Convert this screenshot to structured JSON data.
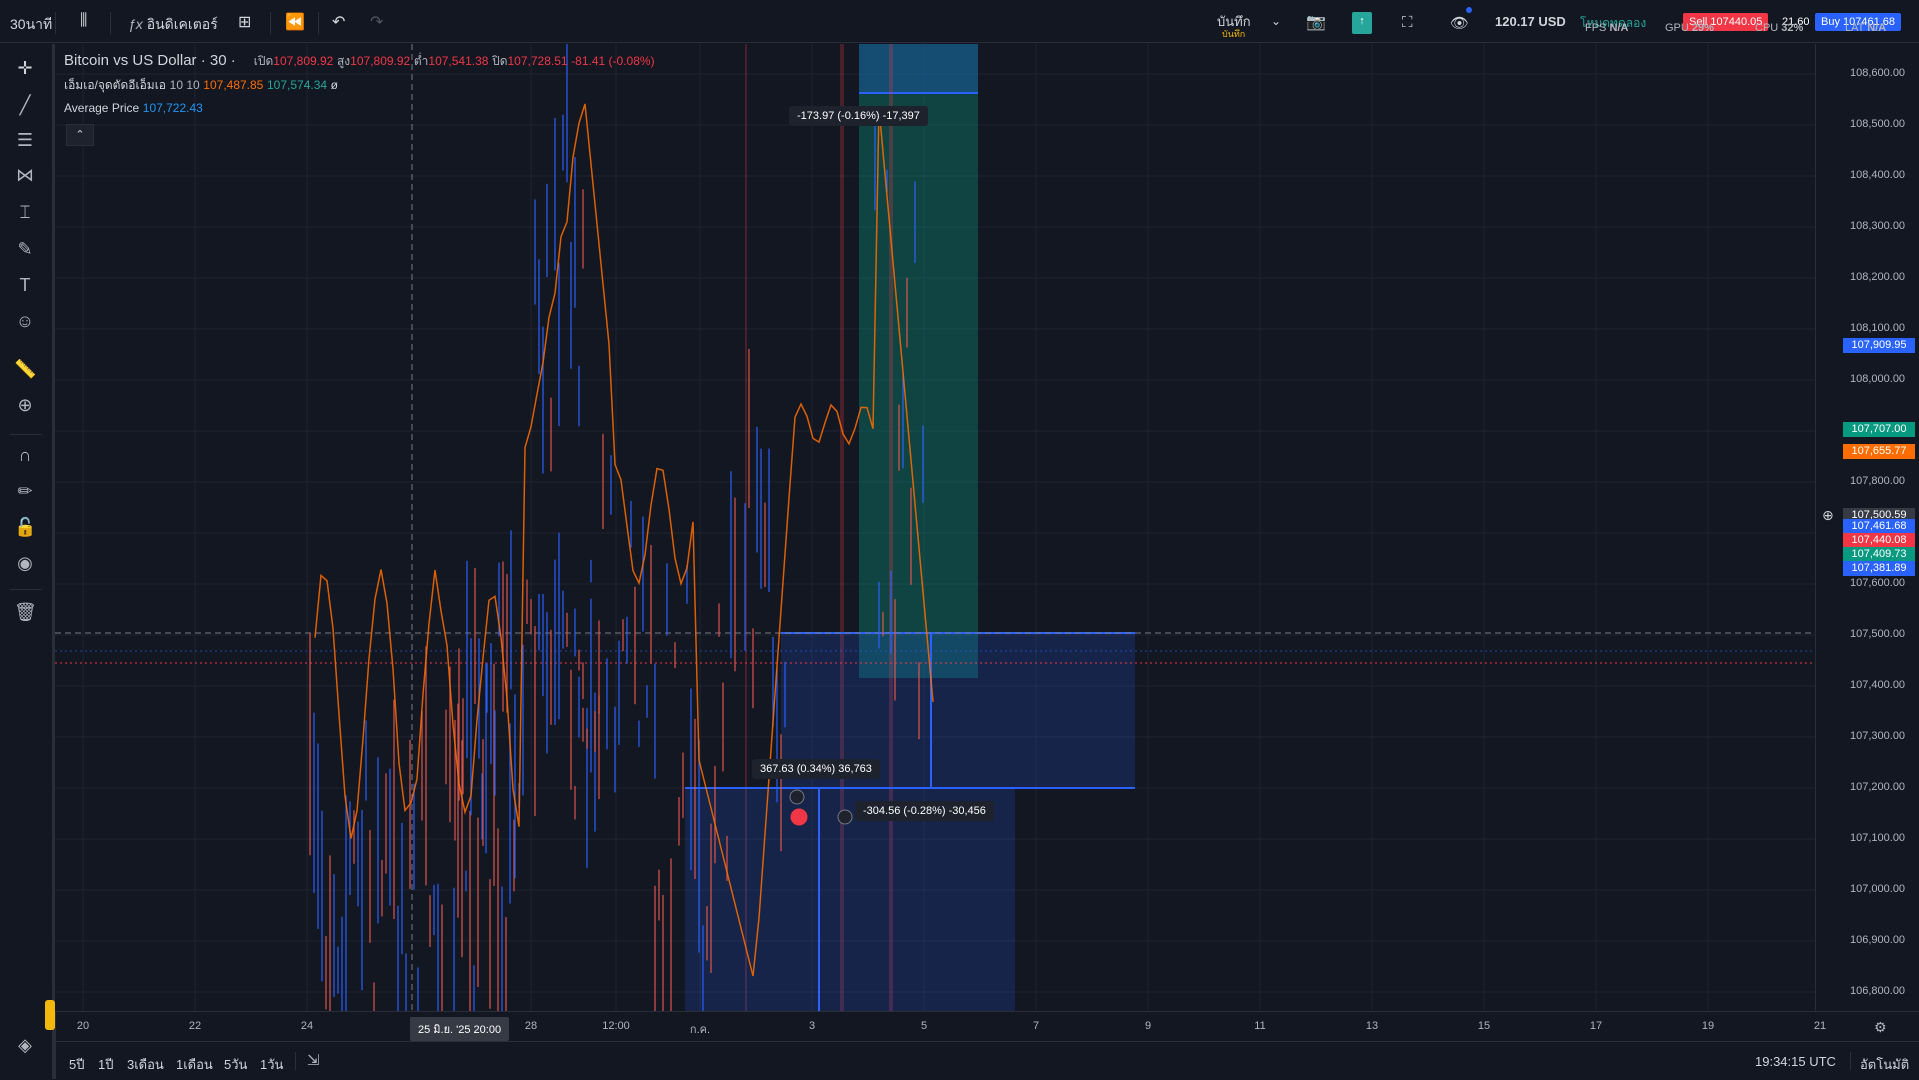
{
  "topbar": {
    "interval": "30นาที",
    "indicators_label": "อินดิเคเตอร์",
    "save_label": "บันทึก",
    "save_sublabel": "บันทึก",
    "account_value": "120.17 USD",
    "fps_label": "FPS",
    "fps_value": "N/A",
    "gpu_label": "GPU",
    "gpu_value": "29%",
    "cpu_label": "CPU",
    "cpu_value": "32%",
    "lat_label": "LAT",
    "lat_value": "N/A",
    "trade_badge": "โหมดทดลอง",
    "sell_label": "Sell 107440.05",
    "spread": "21.60",
    "buy_label": "Buy 107461.68"
  },
  "legend": {
    "symbol": "Bitcoin vs US Dollar · 30 ·",
    "open_label": "เปิด",
    "open_value": "107,809.92",
    "high_label": "สูง",
    "high_value": "107,809.92",
    "low_label": "ต่ำ",
    "low_value": "107,541.38",
    "close_label": "ปิด",
    "close_value": "107,728.51",
    "change_value": "-81.41 (-0.08%)",
    "ma_label": "เอ็มเอ/จุดตัดอีเอ็มเอ",
    "ma_params": "10 10",
    "ma_value1": "107,487.85",
    "ma_value2": "107,574.34",
    "ma_symbol": "ø",
    "avg_label": "Average Price",
    "avg_value": "107,722.43"
  },
  "price_axis": {
    "ticks": [
      "108,600.00",
      "108,500.00",
      "108,400.00",
      "108,300.00",
      "108,200.00",
      "108,100.00",
      "108,000.00",
      "107,900.00",
      "107,800.00",
      "107,700.00",
      "107,600.00",
      "107,500.00",
      "107,400.00",
      "107,300.00",
      "107,200.00",
      "107,100.00",
      "107,000.00",
      "106,900.00",
      "106,800.00"
    ],
    "labels": [
      {
        "text": "107,909.95",
        "color": "#2962ff"
      },
      {
        "text": "107,707.00",
        "color": "#089981"
      },
      {
        "text": "107,655.77",
        "color": "#ff6d00"
      },
      {
        "text": "107,500.59",
        "color": "#363a45"
      },
      {
        "text": "107,461.68",
        "color": "#2962ff"
      },
      {
        "text": "107,440.08",
        "color": "#f23645"
      },
      {
        "text": "107,409.73",
        "color": "#089981"
      },
      {
        "text": "107,381.89",
        "color": "#2962ff"
      }
    ]
  },
  "time_axis": {
    "ticks": [
      "20",
      "22",
      "24",
      "28",
      "12:00",
      "ก.ค.",
      "3",
      "5",
      "7",
      "9",
      "11",
      "13",
      "15",
      "17",
      "19",
      "21"
    ],
    "cursor_label": "25 มิ.ย. '25   20:00"
  },
  "measures": {
    "top": "-173.97 (-0.16%) -17,397",
    "mid": "367.63 (0.34%) 36,763",
    "low": "-304.56 (-0.28%) -30,456"
  },
  "bottombar": {
    "ranges": [
      "5ปี",
      "1ปี",
      "3เดือน",
      "1เดือน",
      "5วัน",
      "1วัน"
    ],
    "clock": "19:34:15 UTC",
    "auto_label": "อัตโนมัติ"
  },
  "colors": {
    "background": "#131722",
    "grid": "#1f2330",
    "accent": "#2962ff",
    "up": "#089981",
    "down": "#f23645",
    "ma": "#ff6d00"
  }
}
